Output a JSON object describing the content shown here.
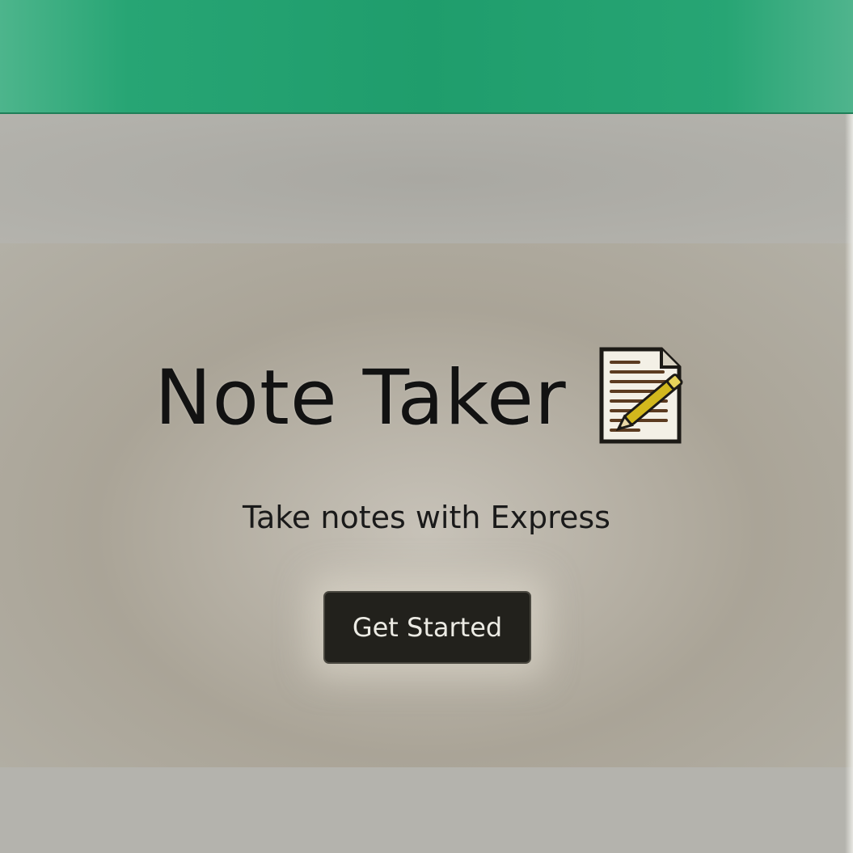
{
  "header": {
    "title": "Note Taker",
    "icon": "memo-icon"
  },
  "hero": {
    "subtitle": "Take notes with Express",
    "cta_label": "Get Started"
  },
  "colors": {
    "navbar": "#1f9d6c",
    "button_bg": "#22211c",
    "button_text": "#ecebe4",
    "title_text": "#121212"
  }
}
